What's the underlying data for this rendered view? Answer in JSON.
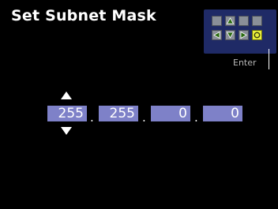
{
  "screen": {
    "title": "Set Subnet Mask"
  },
  "keypad": {
    "enter_label": "Enter",
    "keys_row1": [
      "blank",
      "up",
      "blank",
      "blank"
    ],
    "keys_row2": [
      "left",
      "down",
      "right",
      "enter"
    ],
    "colors": {
      "background": "#1f2a66",
      "key": "#8a8f98",
      "key_active": "#e8ef3c"
    }
  },
  "ip_editor": {
    "octets": [
      "255",
      "255",
      "0",
      "0"
    ],
    "separator": ".",
    "selected_octet": 1,
    "colors": {
      "field": "#7e81c8"
    }
  }
}
